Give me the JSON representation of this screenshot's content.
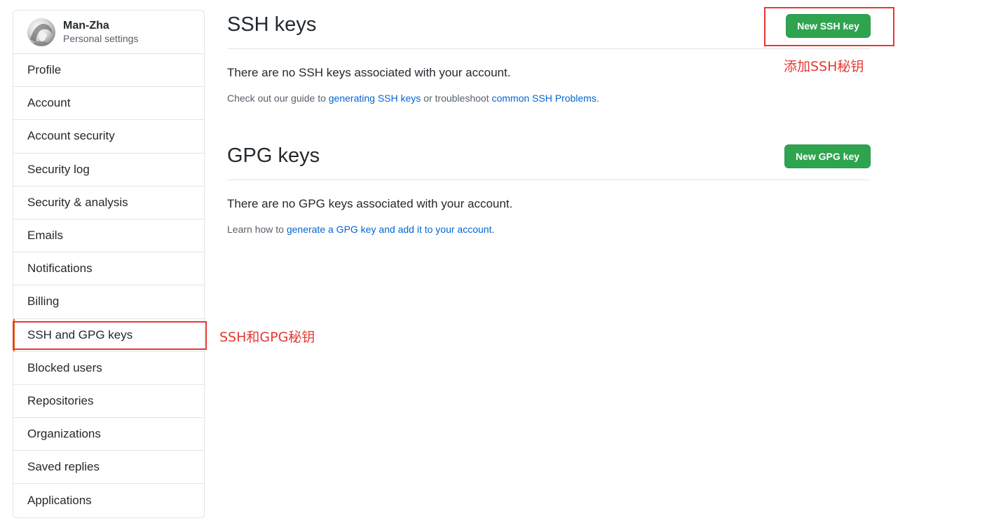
{
  "profile": {
    "name": "Man-Zha",
    "subtitle": "Personal settings"
  },
  "sidebar": {
    "items": [
      {
        "label": "Profile"
      },
      {
        "label": "Account"
      },
      {
        "label": "Account security"
      },
      {
        "label": "Security log"
      },
      {
        "label": "Security & analysis"
      },
      {
        "label": "Emails"
      },
      {
        "label": "Notifications"
      },
      {
        "label": "Billing"
      },
      {
        "label": "SSH and GPG keys",
        "selected": true
      },
      {
        "label": "Blocked users"
      },
      {
        "label": "Repositories"
      },
      {
        "label": "Organizations"
      },
      {
        "label": "Saved replies"
      },
      {
        "label": "Applications"
      }
    ]
  },
  "ssh": {
    "title": "SSH keys",
    "button": "New SSH key",
    "empty": "There are no SSH keys associated with your account.",
    "note_prefix": "Check out our guide to ",
    "link1": "generating SSH keys",
    "note_mid": " or troubleshoot ",
    "link2": "common SSH Problems",
    "note_suffix": "."
  },
  "gpg": {
    "title": "GPG keys",
    "button": "New GPG key",
    "empty": "There are no GPG keys associated with your account.",
    "note_prefix": "Learn how to ",
    "link": "generate a GPG key and add it to your account",
    "note_suffix": "."
  },
  "annotations": {
    "sidebar_note": "SSH和GPG秘钥",
    "button_note": "添加SSH秘钥"
  },
  "colors": {
    "accent_green": "#2ea44f",
    "link_blue": "#0366d6",
    "annotation_red": "#e53935",
    "selected_marker": "#e36209"
  }
}
